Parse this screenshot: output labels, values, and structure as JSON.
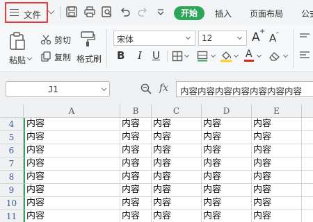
{
  "menubar": {
    "file_label": "文件",
    "start_tab": "开始",
    "tabs": [
      "插入",
      "页面布局",
      "公式"
    ],
    "toolbar_icons": [
      "save-icon",
      "print-icon",
      "print-preview-icon",
      "undo-icon",
      "redo-icon",
      "more-icon"
    ]
  },
  "ribbon": {
    "paste_label": "粘贴",
    "cut_label": "剪切",
    "copy_label": "复制",
    "format_painter_label": "格式刷",
    "font_name": "宋体",
    "font_size": "12",
    "bold": "B",
    "italic": "I",
    "underline": "U",
    "grow_font": "A",
    "shrink_font": "A",
    "font_color_letter": "A",
    "accent_color": "#2fa55a",
    "highlight_color": "#f5d33c",
    "font_color": "#d9261c"
  },
  "formula_bar": {
    "name_box": "J1",
    "fx_label": "fx",
    "formula": "内容内容内容内容内容内容内容"
  },
  "grid": {
    "columns": [
      "A",
      "B",
      "C",
      "D",
      "E"
    ],
    "rows": [
      {
        "num": "4",
        "cells": [
          "内容",
          "内容",
          "内容",
          "内容",
          "内容"
        ]
      },
      {
        "num": "5",
        "cells": [
          "内容",
          "内容",
          "内容",
          "内容",
          "内容"
        ]
      },
      {
        "num": "6",
        "cells": [
          "内容",
          "内容",
          "内容",
          "内容",
          "内容"
        ]
      },
      {
        "num": "7",
        "cells": [
          "内容",
          "内容",
          "内容",
          "内容",
          "内容"
        ]
      },
      {
        "num": "8",
        "cells": [
          "内容",
          "内容",
          "内容",
          "内容",
          "内容"
        ]
      },
      {
        "num": "9",
        "cells": [
          "内容",
          "内容",
          "内容",
          "内容",
          "内容"
        ]
      },
      {
        "num": "10",
        "cells": [
          "内容",
          "内容",
          "内容",
          "内容",
          "内容"
        ]
      },
      {
        "num": "11",
        "cells": [
          "内容",
          "内容",
          "内容",
          "内容",
          "内容"
        ]
      }
    ]
  }
}
